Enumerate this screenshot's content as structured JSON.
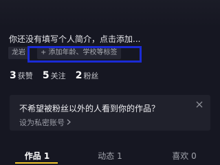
{
  "profile": {
    "bio_prompt": "你还没有填写个人简介，点击添加...",
    "tags": {
      "location": "龙岩",
      "add_tag": "+ 添加年龄、学校等标签"
    },
    "stats": [
      {
        "count": "3",
        "label": "获赞"
      },
      {
        "count": "5",
        "label": "关注"
      },
      {
        "count": "2",
        "label": "粉丝"
      }
    ]
  },
  "privacy_card": {
    "title": "不希望被粉丝以外的人看到你的作品？",
    "action": "设为私密账号",
    "close_icon": "close-icon",
    "chevron_icon": "chevron-right-icon"
  },
  "tabs": [
    {
      "label": "作品 1",
      "active": true
    },
    {
      "label": "动态 1",
      "active": false
    },
    {
      "label": "喜欢 0",
      "active": false
    }
  ],
  "colors": {
    "background": "#161722",
    "highlight_box": "#1b2bd6",
    "tab_underline": "#f4c82e"
  }
}
